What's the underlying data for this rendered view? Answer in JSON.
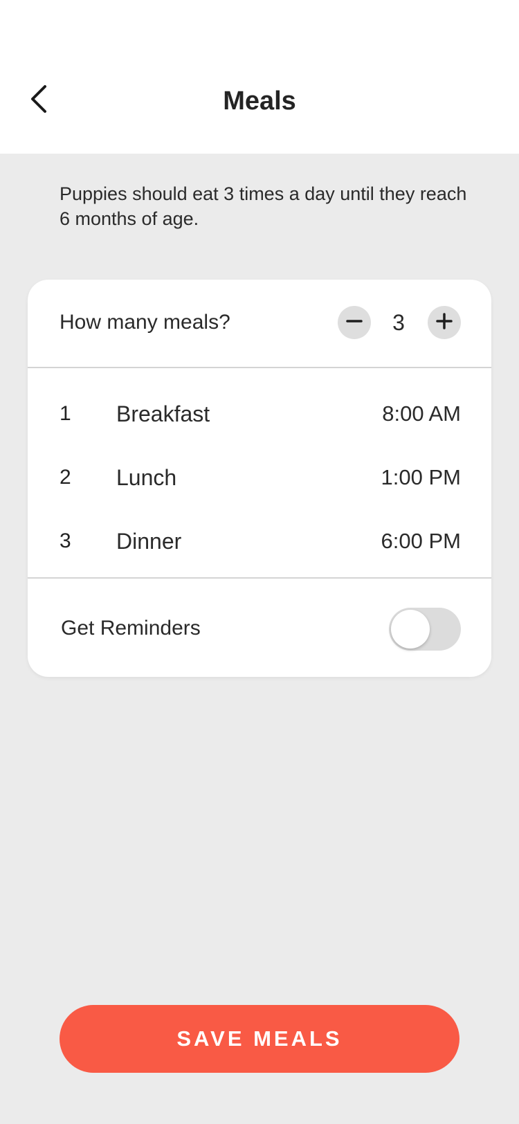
{
  "header": {
    "title": "Meals",
    "back_icon": "chevron-left-icon"
  },
  "intro_text": "Puppies should eat 3 times a day until they reach 6 months of age.",
  "meal_count": {
    "label": "How many meals?",
    "value": "3",
    "decrement_icon": "minus-icon",
    "increment_icon": "plus-icon"
  },
  "meals": [
    {
      "number": "1",
      "name": "Breakfast",
      "time": "8:00 AM"
    },
    {
      "number": "2",
      "name": "Lunch",
      "time": "1:00 PM"
    },
    {
      "number": "3",
      "name": "Dinner",
      "time": "6:00 PM"
    }
  ],
  "reminders": {
    "label": "Get Reminders",
    "enabled": false
  },
  "save_button": {
    "label": "SAVE MEALS"
  },
  "colors": {
    "accent": "#f95a45",
    "background": "#ebebeb",
    "card": "#ffffff"
  }
}
